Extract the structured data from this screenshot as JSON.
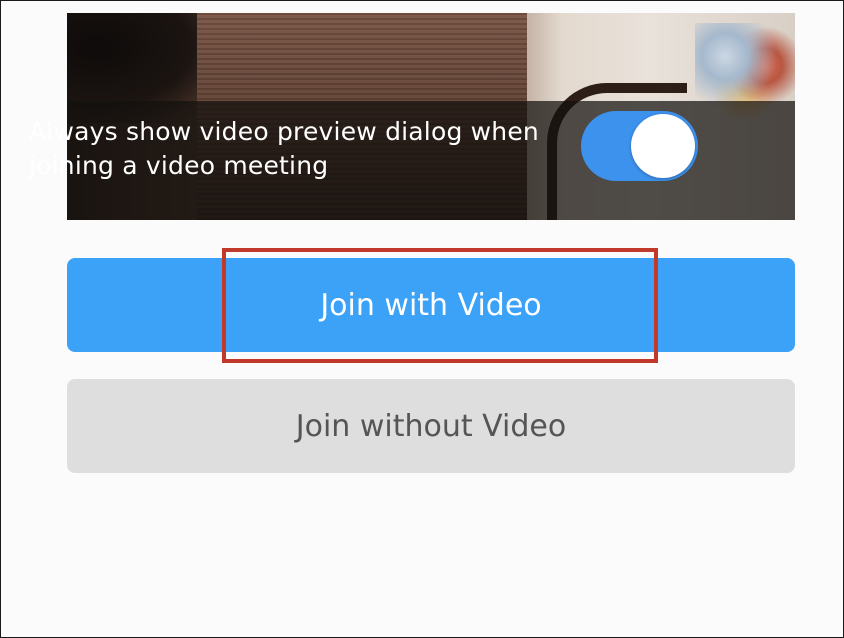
{
  "preview": {
    "toggle_label": "Always show video preview dialog when joining a video meeting",
    "toggle_on": true,
    "toggle_color": "#3d92ee"
  },
  "buttons": {
    "join_with_video": "Join with Video",
    "join_without_video": "Join without Video"
  },
  "colors": {
    "primary": "#3ba2f7",
    "secondary": "#dedede",
    "highlight": "#c0392b"
  }
}
